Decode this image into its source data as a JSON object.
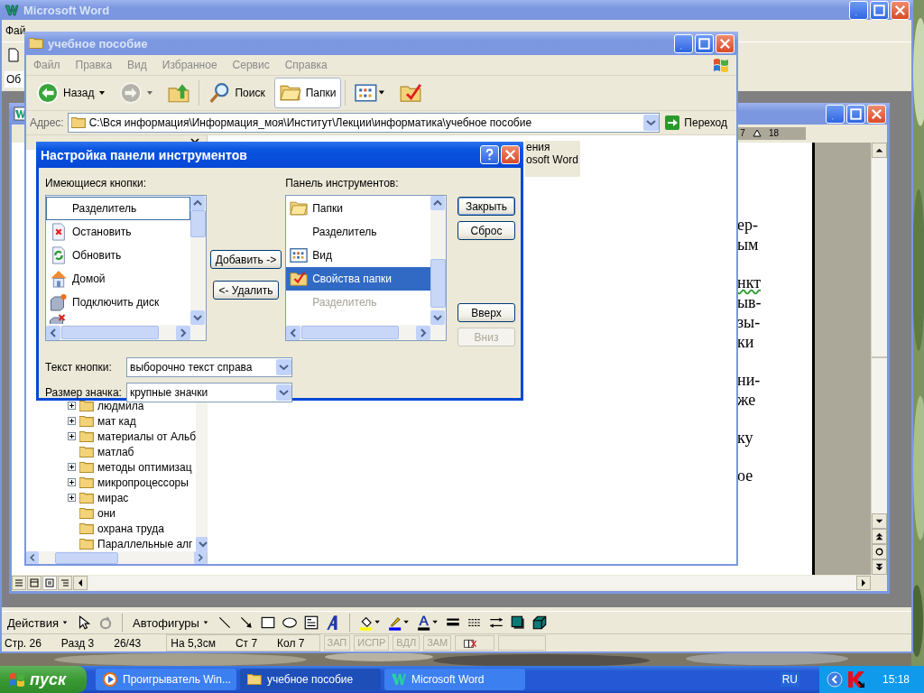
{
  "word": {
    "title": "Microsoft Word",
    "menu_fragment": "Фай",
    "style_field": "Об",
    "document": {
      "ruler_labels": [
        "7",
        "18"
      ],
      "paragraphs": [
        {
          "lines": [
            {
              "text": "ер-",
              "flagged": false
            },
            {
              "text": "ым",
              "flagged": false
            }
          ]
        },
        {
          "lines": [
            {
              "text": "нкт",
              "flagged": true
            },
            {
              "text": "ыв-",
              "flagged": false
            },
            {
              "text": "зы-",
              "flagged": false
            },
            {
              "text": "ки",
              "flagged": false
            }
          ]
        },
        {
          "lines": [
            {
              "text": "ни-",
              "flagged": false
            },
            {
              "text": "же",
              "flagged": false
            }
          ]
        },
        {
          "lines": [
            {
              "text": "ку",
              "flagged": false
            }
          ]
        },
        {
          "lines": [
            {
              "text": "ое",
              "flagged": false
            }
          ]
        }
      ]
    },
    "drawing_toolbar": {
      "actions": "Действия",
      "autoshapes": "Автофигуры"
    },
    "status_bar": {
      "position": [
        "Стр. 26",
        "Разд 3",
        "26/43"
      ],
      "cursor": [
        "На 5,3см",
        "Ст 7",
        "Кол 7"
      ],
      "indicators": [
        {
          "label": "ЗАП",
          "disabled": true
        },
        {
          "label": "ИСПР",
          "disabled": true
        },
        {
          "label": "ВДЛ",
          "disabled": true
        },
        {
          "label": "ЗАМ",
          "disabled": true
        }
      ]
    }
  },
  "explorer": {
    "title": "учебное пособие",
    "menu": [
      "Файл",
      "Правка",
      "Вид",
      "Избранное",
      "Сервис",
      "Справка"
    ],
    "toolbar": [
      {
        "kind": "back",
        "label": "Назад",
        "selected": false,
        "disabled": false
      },
      {
        "kind": "forward",
        "selected": false,
        "disabled": true
      },
      {
        "kind": "up",
        "selected": false,
        "disabled": false
      },
      {
        "kind": "search",
        "label": "Поиск",
        "selected": false,
        "disabled": false
      },
      {
        "kind": "folders",
        "label": "Папки",
        "selected": true,
        "disabled": false
      },
      {
        "kind": "views",
        "selected": false,
        "disabled": false
      },
      {
        "kind": "props",
        "selected": false,
        "disabled": false
      }
    ],
    "address_label": "Адрес:",
    "address": "C:\\Вся информация\\Информация_моя\\Институт\\Лекции\\информатика\\учебное пособие",
    "go": "Переход",
    "tree": [
      {
        "label": "людмила",
        "expandable": true
      },
      {
        "label": "мат кад",
        "expandable": true
      },
      {
        "label": "материалы от Альб",
        "expandable": true
      },
      {
        "label": "матлаб",
        "expandable": false
      },
      {
        "label": "методы оптимизац",
        "expandable": true
      },
      {
        "label": "микропроцессоры",
        "expandable": true
      },
      {
        "label": "мирас",
        "expandable": true
      },
      {
        "label": "они",
        "expandable": false
      },
      {
        "label": "охрана труда",
        "expandable": false
      },
      {
        "label": "Параллельные алг",
        "expandable": false
      }
    ],
    "file_label": [
      "ения",
      "osoft Word"
    ]
  },
  "dialog": {
    "title": "Настройка панели инструментов",
    "available_label": "Имеющиеся кнопки:",
    "available": [
      {
        "label": "Разделитель",
        "kind": "separator",
        "focused": true,
        "selected": false,
        "disabled": false
      },
      {
        "label": "Остановить",
        "kind": "stop",
        "focused": false,
        "selected": false,
        "disabled": false
      },
      {
        "label": "Обновить",
        "kind": "refresh",
        "focused": false,
        "selected": false,
        "disabled": false
      },
      {
        "label": "Домой",
        "kind": "home",
        "focused": false,
        "selected": false,
        "disabled": false
      },
      {
        "label": "Подключить диск",
        "kind": "drive",
        "focused": false,
        "selected": false,
        "disabled": false
      }
    ],
    "add": "Добавить ->",
    "remove": "<- Удалить",
    "toolbar_label": "Панель инструментов:",
    "current": [
      {
        "label": "Папки",
        "kind": "folder",
        "focused": false,
        "selected": false,
        "disabled": false
      },
      {
        "label": "Разделитель",
        "kind": "separator",
        "focused": false,
        "selected": false,
        "disabled": false
      },
      {
        "label": "Вид",
        "kind": "view",
        "focused": false,
        "selected": false,
        "disabled": false
      },
      {
        "label": "Свойства папки",
        "kind": "props",
        "focused": false,
        "selected": true,
        "disabled": false
      },
      {
        "label": "Разделитель",
        "kind": "separator",
        "focused": false,
        "selected": false,
        "disabled": true
      }
    ],
    "buttons": [
      {
        "label": "Закрыть",
        "disabled": false,
        "default": true
      },
      {
        "label": "Сброс",
        "disabled": false,
        "default": false
      },
      {
        "label": "Вверх",
        "disabled": false,
        "default": false
      },
      {
        "label": "Вниз",
        "disabled": true,
        "default": false
      }
    ],
    "text_option": {
      "label": "Текст кнопки:",
      "value": "выборочно текст справа"
    },
    "icon_option": {
      "label": "Размер значка:",
      "value": "крупные значки"
    }
  },
  "taskbar": {
    "start": "пуск",
    "tasks": [
      {
        "label": "Проигрыватель Win...",
        "kind": "player",
        "selected": false
      },
      {
        "label": "учебное пособие",
        "kind": "folder",
        "selected": true
      },
      {
        "label": "Microsoft Word",
        "kind": "word",
        "selected": false
      }
    ],
    "language": "RU",
    "clock": "15:18"
  }
}
